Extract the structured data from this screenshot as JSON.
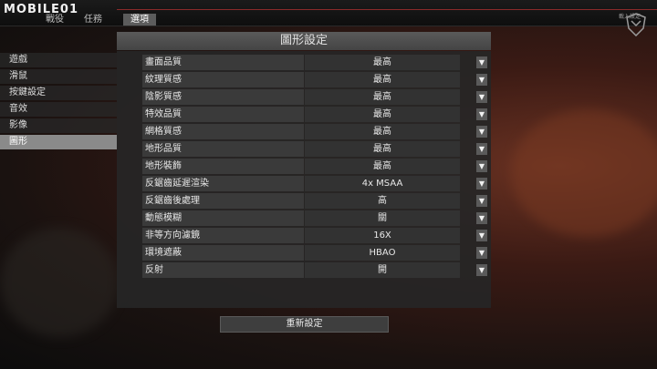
{
  "watermark": {
    "logo_text": "MOBILE01"
  },
  "top_tabs": [
    {
      "label": "戰役"
    },
    {
      "label": "任務"
    },
    {
      "label": "選項"
    }
  ],
  "emblem": {
    "label": "載入設定"
  },
  "panel": {
    "title": "圖形設定"
  },
  "sidebar": {
    "items": [
      {
        "label": "遊戲"
      },
      {
        "label": "滑鼠"
      },
      {
        "label": "按鍵設定"
      },
      {
        "label": "音效"
      },
      {
        "label": "影像"
      },
      {
        "label": "圖形"
      }
    ],
    "active_index": 5
  },
  "settings": [
    {
      "label": "畫面品質",
      "value": "最高"
    },
    {
      "label": "紋理質感",
      "value": "最高"
    },
    {
      "label": "陰影質感",
      "value": "最高"
    },
    {
      "label": "特效品質",
      "value": "最高"
    },
    {
      "label": "網格質感",
      "value": "最高"
    },
    {
      "label": "地形品質",
      "value": "最高"
    },
    {
      "label": "地形裝飾",
      "value": "最高"
    },
    {
      "label": "反鋸齒延遲渲染",
      "value": "4x MSAA"
    },
    {
      "label": "反鋸齒後處理",
      "value": "高"
    },
    {
      "label": "動態模糊",
      "value": "關"
    },
    {
      "label": "非等方向濾鏡",
      "value": "16X"
    },
    {
      "label": "環境遮蔽",
      "value": "HBAO"
    },
    {
      "label": "反射",
      "value": "開"
    }
  ],
  "dropdown_arrow_icon": "▼",
  "reset": {
    "label": "重新設定"
  },
  "colors": {
    "accent_red": "#8a2a2a",
    "active_tab": "#5c5c5c",
    "active_sidebar": "#8a8a8a"
  }
}
